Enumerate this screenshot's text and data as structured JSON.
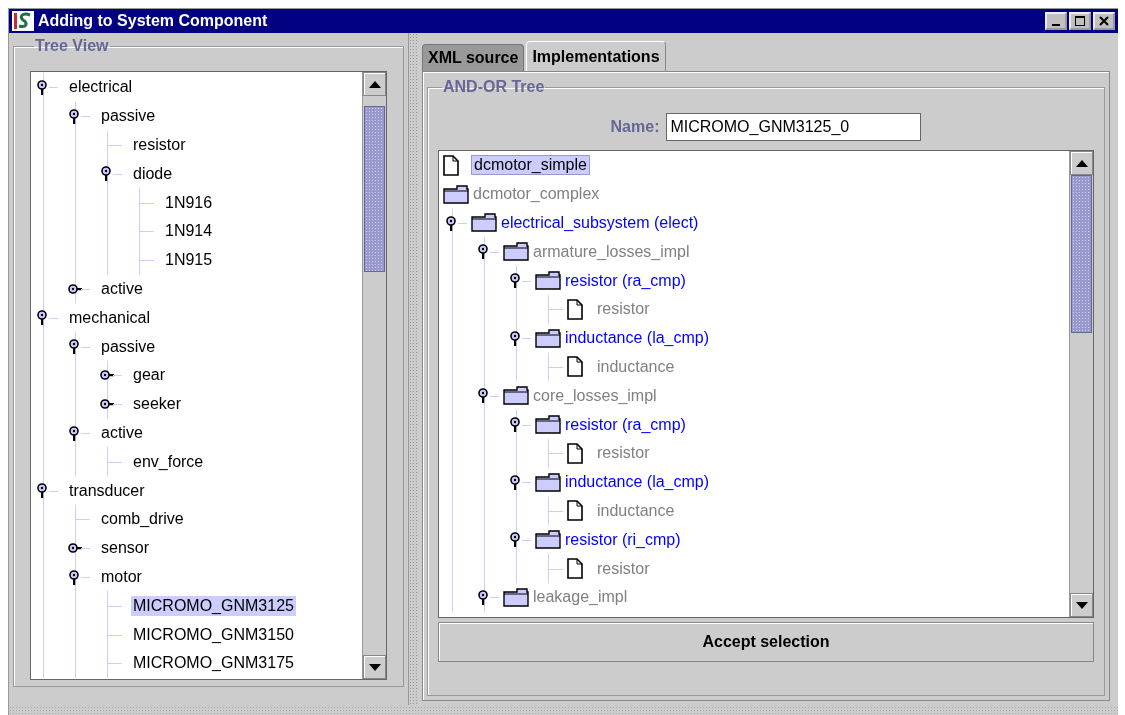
{
  "window": {
    "title": "Adding to System Component"
  },
  "tree_view": {
    "title": "Tree View",
    "items": [
      {
        "label": "electrical",
        "expanded": true,
        "selected": false,
        "children": [
          {
            "label": "passive",
            "expanded": true,
            "selected": false,
            "children": [
              {
                "label": "resistor",
                "selected": false
              },
              {
                "label": "diode",
                "expanded": true,
                "selected": false,
                "children": [
                  {
                    "label": "1N916",
                    "selected": false
                  },
                  {
                    "label": "1N914",
                    "selected": false
                  },
                  {
                    "label": "1N915",
                    "selected": false
                  }
                ]
              }
            ]
          },
          {
            "label": "active",
            "expanded": false,
            "selected": false
          }
        ]
      },
      {
        "label": "mechanical",
        "expanded": true,
        "selected": false,
        "children": [
          {
            "label": "passive",
            "expanded": true,
            "selected": false,
            "children": [
              {
                "label": "gear",
                "expanded": false,
                "selected": false
              },
              {
                "label": "seeker",
                "expanded": false,
                "selected": false
              }
            ]
          },
          {
            "label": "active",
            "expanded": true,
            "selected": false,
            "children": [
              {
                "label": "env_force",
                "selected": false
              }
            ]
          }
        ]
      },
      {
        "label": "transducer",
        "expanded": true,
        "selected": false,
        "children": [
          {
            "label": "comb_drive",
            "selected": false
          },
          {
            "label": "sensor",
            "expanded": false,
            "selected": false
          },
          {
            "label": "motor",
            "expanded": true,
            "selected": false,
            "children": [
              {
                "label": "MICROMO_GNM3125",
                "selected": true
              },
              {
                "label": "MICROMO_GNM3150",
                "selected": false
              },
              {
                "label": "MICROMO_GNM3175",
                "selected": false
              }
            ]
          }
        ]
      }
    ]
  },
  "tabs": [
    {
      "label": "XML source",
      "selected": false
    },
    {
      "label": "Implementations",
      "selected": true
    }
  ],
  "and_or_tree": {
    "title": "AND-OR Tree",
    "name_label": "Name:",
    "name_value": "MICROMO_GNM3125_0",
    "items": [
      {
        "label": "dcmotor_simple",
        "kind": "document",
        "color": "#000000",
        "selected": true
      },
      {
        "label": "dcmotor_complex",
        "kind": "folder",
        "color": "#808080",
        "selected": false,
        "children": [
          {
            "label": "electrical_subsystem (elect)",
            "kind": "folder",
            "color": "#0000ff",
            "expanded": true,
            "selected": false,
            "children": [
              {
                "label": "armature_losses_impl",
                "kind": "folder",
                "color": "#808080",
                "expanded": true,
                "selected": false,
                "children": [
                  {
                    "label": "resistor (ra_cmp)",
                    "kind": "folder",
                    "color": "#0000ff",
                    "expanded": true,
                    "selected": false,
                    "children": [
                      {
                        "label": "resistor",
                        "kind": "document",
                        "color": "#808080",
                        "selected": false
                      }
                    ]
                  },
                  {
                    "label": "inductance (la_cmp)",
                    "kind": "folder",
                    "color": "#0000ff",
                    "expanded": true,
                    "selected": false,
                    "children": [
                      {
                        "label": "inductance",
                        "kind": "document",
                        "color": "#808080",
                        "selected": false
                      }
                    ]
                  }
                ]
              },
              {
                "label": "core_losses_impl",
                "kind": "folder",
                "color": "#808080",
                "expanded": true,
                "selected": false,
                "children": [
                  {
                    "label": "resistor (ra_cmp)",
                    "kind": "folder",
                    "color": "#0000ff",
                    "expanded": true,
                    "selected": false,
                    "children": [
                      {
                        "label": "resistor",
                        "kind": "document",
                        "color": "#808080",
                        "selected": false
                      }
                    ]
                  },
                  {
                    "label": "inductance (la_cmp)",
                    "kind": "folder",
                    "color": "#0000ff",
                    "expanded": true,
                    "selected": false,
                    "children": [
                      {
                        "label": "inductance",
                        "kind": "document",
                        "color": "#808080",
                        "selected": false
                      }
                    ]
                  },
                  {
                    "label": "resistor (ri_cmp)",
                    "kind": "folder",
                    "color": "#0000ff",
                    "expanded": true,
                    "selected": false,
                    "children": [
                      {
                        "label": "resistor",
                        "kind": "document",
                        "color": "#808080",
                        "selected": false
                      }
                    ]
                  }
                ]
              },
              {
                "label": "leakage_impl",
                "kind": "folder",
                "color": "#808080",
                "expanded": true,
                "selected": false
              }
            ]
          }
        ]
      }
    ],
    "accept_button": "Accept selection"
  }
}
